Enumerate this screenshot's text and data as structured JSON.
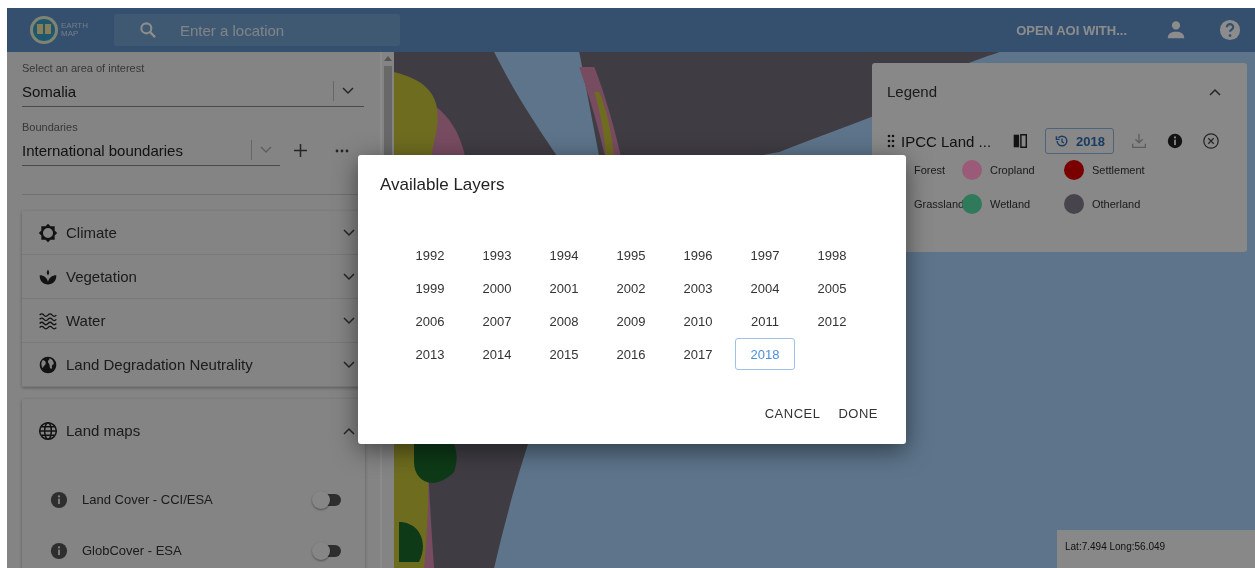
{
  "header": {
    "logo_text": [
      "EARTH",
      "MAP"
    ],
    "search": {
      "placeholder": "Enter a location"
    },
    "open_button": "OPEN AOI WITH..."
  },
  "sidebar": {
    "aoi": {
      "label": "Select an area of interest",
      "value": "Somalia"
    },
    "boundaries": {
      "label": "Boundaries",
      "value": "International boundaries"
    },
    "sections": [
      {
        "label": "Climate",
        "expanded": false
      },
      {
        "label": "Vegetation",
        "expanded": false
      },
      {
        "label": "Water",
        "expanded": false
      },
      {
        "label": "Land Degradation Neutrality",
        "expanded": false
      }
    ],
    "land_maps": {
      "label": "Land maps",
      "expanded": true,
      "layers": [
        {
          "label": "Land Cover - CCI/ESA",
          "on": false
        },
        {
          "label": "GlobCover - ESA",
          "on": false
        }
      ]
    }
  },
  "legend": {
    "title": "Legend",
    "expanded": true,
    "layer": {
      "name": "IPCC Land ...",
      "year": "2018"
    },
    "classes": [
      {
        "label": "Forest"
      },
      {
        "label": "Cropland",
        "color": "#9a5a78"
      },
      {
        "label": "Settlement",
        "color": "#7a0000"
      },
      {
        "label": "Grassland"
      },
      {
        "label": "Wetland",
        "color": "#2e7a5a"
      },
      {
        "label": "Otherland",
        "color": "#48444c"
      }
    ]
  },
  "coordinates": "Lat:7.494 Long:56.049",
  "dialog": {
    "title": "Available Layers",
    "years": [
      {
        "label": "1992",
        "selected": false
      },
      {
        "label": "1993",
        "selected": false
      },
      {
        "label": "1994",
        "selected": false
      },
      {
        "label": "1995",
        "selected": false
      },
      {
        "label": "1996",
        "selected": false
      },
      {
        "label": "1997",
        "selected": false
      },
      {
        "label": "1998",
        "selected": false
      },
      {
        "label": "1999",
        "selected": false
      },
      {
        "label": "2000",
        "selected": false
      },
      {
        "label": "2001",
        "selected": false
      },
      {
        "label": "2002",
        "selected": false
      },
      {
        "label": "2003",
        "selected": false
      },
      {
        "label": "2004",
        "selected": false
      },
      {
        "label": "2005",
        "selected": false
      },
      {
        "label": "2006",
        "selected": false
      },
      {
        "label": "2007",
        "selected": false
      },
      {
        "label": "2008",
        "selected": false
      },
      {
        "label": "2009",
        "selected": false
      },
      {
        "label": "2010",
        "selected": false
      },
      {
        "label": "2011",
        "selected": false
      },
      {
        "label": "2012",
        "selected": false
      },
      {
        "label": "2013",
        "selected": false
      },
      {
        "label": "2014",
        "selected": false
      },
      {
        "label": "2015",
        "selected": false
      },
      {
        "label": "2016",
        "selected": false
      },
      {
        "label": "2017",
        "selected": false
      },
      {
        "label": "2018",
        "selected": true
      }
    ],
    "buttons": [
      "CANCEL",
      "DONE"
    ]
  }
}
